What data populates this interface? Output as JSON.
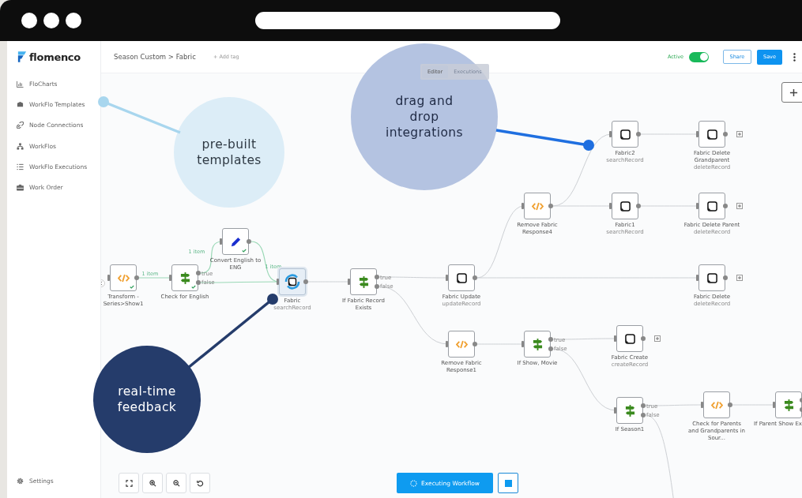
{
  "app": {
    "logo": "flomenco",
    "breadcrumb": "Season Custom > Fabric",
    "add_tag": "+ Add tag"
  },
  "sidebar": {
    "items": [
      {
        "label": "FloCharts"
      },
      {
        "label": "WorkFlo Templates"
      },
      {
        "label": "Node Connections"
      },
      {
        "label": "WorkFlos"
      },
      {
        "label": "WorkFlo Executions"
      },
      {
        "label": "Work Order"
      }
    ],
    "settings": "Settings"
  },
  "tabs": [
    {
      "label": "Editor",
      "selected": true
    },
    {
      "label": "Executions",
      "selected": false
    }
  ],
  "active_toggle": {
    "label": "Active",
    "on": true
  },
  "buttons": {
    "share": "Share",
    "save": "Save",
    "execute": "Executing Workflow"
  },
  "connector_labels": [
    "1 item",
    "1 item",
    "1 item"
  ],
  "nodes": [
    {
      "title": "Transform - Series>Show1",
      "kind": "code",
      "checked": true,
      "selected": false
    },
    {
      "title": "Check for English",
      "kind": "if",
      "checked": true,
      "selected": false,
      "outputs": [
        "true",
        "false"
      ]
    },
    {
      "title": "Convert English to ENG",
      "kind": "edit",
      "checked": true,
      "selected": false
    },
    {
      "title": "Fabric",
      "subtitle": "searchRecord",
      "kind": "fabric-sync",
      "checked": false,
      "selected": true
    },
    {
      "title": "If Fabric Record Exists",
      "kind": "if",
      "checked": false,
      "selected": false,
      "outputs": [
        "true",
        "false"
      ]
    },
    {
      "title": "Fabric Update",
      "subtitle": "updateRecord",
      "kind": "fabric",
      "checked": false,
      "selected": false
    },
    {
      "title": "Remove Fabric Response4",
      "kind": "code",
      "checked": false,
      "selected": false
    },
    {
      "title": "Fabric2",
      "subtitle": "searchRecord",
      "kind": "fabric",
      "checked": false,
      "selected": false
    },
    {
      "title": "Fabric Delete Grandparent",
      "subtitle": "deleteRecord",
      "kind": "fabric",
      "checked": false,
      "selected": false,
      "add_after": true
    },
    {
      "title": "Fabric1",
      "subtitle": "searchRecord",
      "kind": "fabric",
      "checked": false,
      "selected": false
    },
    {
      "title": "Fabric Delete Parent",
      "subtitle": "deleteRecord",
      "kind": "fabric",
      "checked": false,
      "selected": false,
      "add_after": true
    },
    {
      "title": "Fabric Delete",
      "subtitle": "deleteRecord",
      "kind": "fabric",
      "checked": false,
      "selected": false,
      "add_after": true
    },
    {
      "title": "Remove Fabric Response1",
      "kind": "code",
      "checked": false,
      "selected": false
    },
    {
      "title": "If Show, Movie",
      "kind": "if",
      "checked": false,
      "selected": false,
      "outputs": [
        "true",
        "false"
      ]
    },
    {
      "title": "Fabric Create",
      "subtitle": "createRecord",
      "kind": "fabric",
      "checked": false,
      "selected": false,
      "add_after": true
    },
    {
      "title": "If Season1",
      "kind": "if",
      "checked": false,
      "selected": false,
      "outputs": [
        "true",
        "false"
      ]
    },
    {
      "title": "Check for Parents and Grandparents in Sour...",
      "kind": "code",
      "checked": false,
      "selected": false
    },
    {
      "title": "If Parent Show Ex",
      "kind": "if",
      "checked": false,
      "selected": false
    }
  ],
  "callouts": [
    {
      "text": "pre-built\ntemplates",
      "color": "#dcedf7"
    },
    {
      "text": "drag and\ndrop\nintegrations",
      "color": "#b4c3e1"
    },
    {
      "text": "real-time\nfeedback",
      "color": "#253c6b"
    }
  ]
}
